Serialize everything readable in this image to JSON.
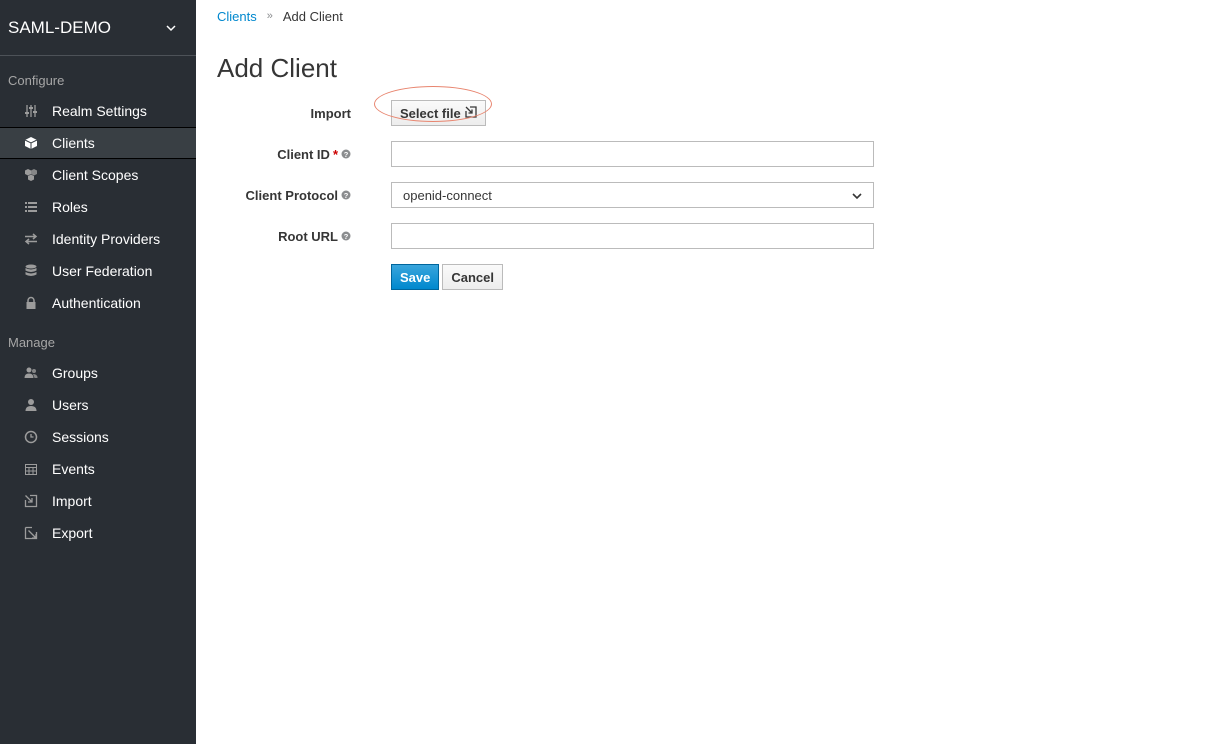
{
  "sidebar": {
    "realm_name": "SAML-DEMO",
    "configure_label": "Configure",
    "manage_label": "Manage",
    "configure_items": [
      {
        "label": "Realm Settings",
        "icon": "sliders-icon"
      },
      {
        "label": "Clients",
        "icon": "cube-icon"
      },
      {
        "label": "Client Scopes",
        "icon": "cubes-icon"
      },
      {
        "label": "Roles",
        "icon": "roles-list-icon"
      },
      {
        "label": "Identity Providers",
        "icon": "exchange-icon"
      },
      {
        "label": "User Federation",
        "icon": "database-icon"
      },
      {
        "label": "Authentication",
        "icon": "lock-icon"
      }
    ],
    "manage_items": [
      {
        "label": "Groups",
        "icon": "users-group-icon"
      },
      {
        "label": "Users",
        "icon": "user-icon"
      },
      {
        "label": "Sessions",
        "icon": "clock-icon"
      },
      {
        "label": "Events",
        "icon": "calendar-icon"
      },
      {
        "label": "Import",
        "icon": "import-icon"
      },
      {
        "label": "Export",
        "icon": "export-icon"
      }
    ],
    "active_item": "Clients"
  },
  "breadcrumb": {
    "parent": "Clients",
    "current": "Add Client"
  },
  "page_title": "Add Client",
  "form": {
    "import_label": "Import",
    "select_file_label": "Select file",
    "client_id_label": "Client ID",
    "required_marker": "*",
    "client_id_value": "",
    "client_protocol_label": "Client Protocol",
    "client_protocol_value": "openid-connect",
    "root_url_label": "Root URL",
    "root_url_value": "",
    "save_label": "Save",
    "cancel_label": "Cancel"
  },
  "colors": {
    "sidebar_bg": "#292e34",
    "link": "#0088ce",
    "primary_button": "#0088ce",
    "highlight": "#e8856f"
  }
}
